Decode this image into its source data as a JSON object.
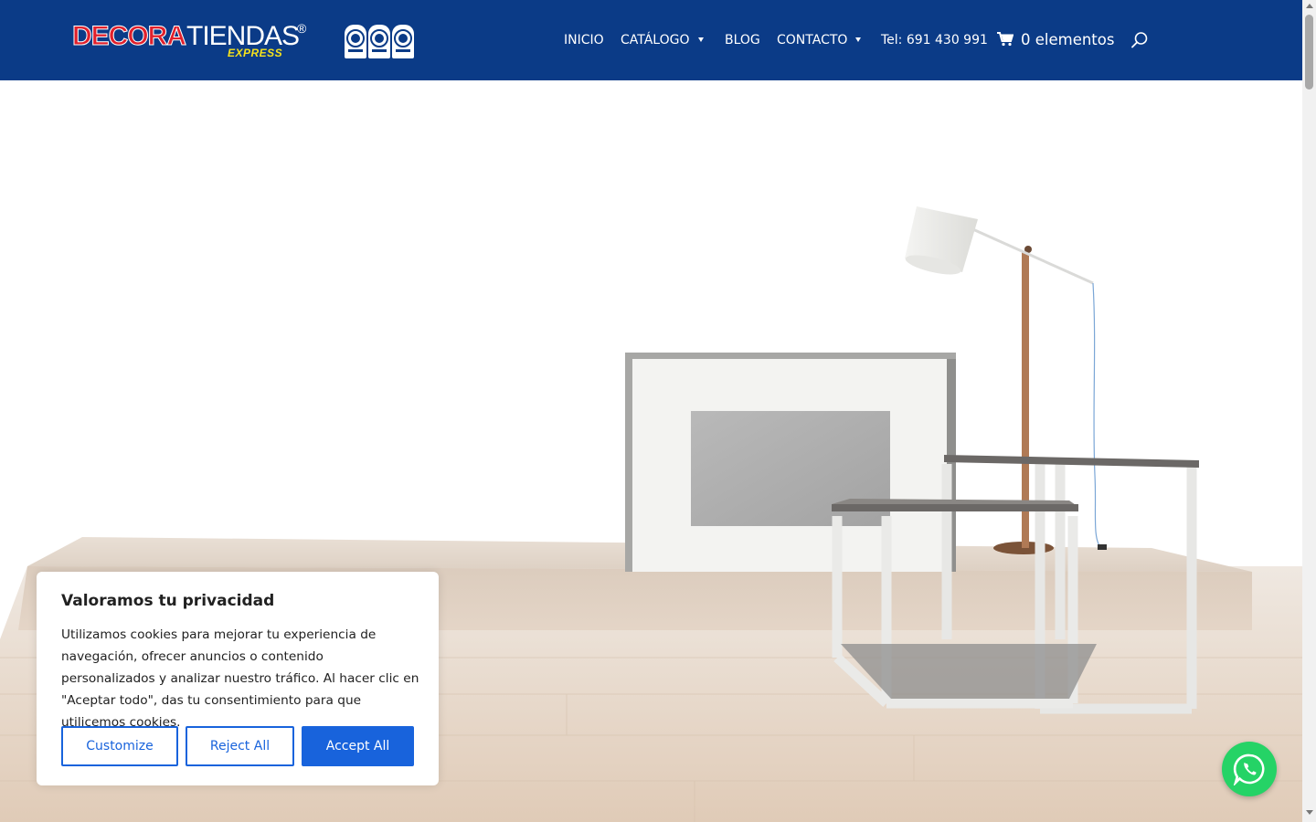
{
  "header": {
    "bg_color": "#0b3b87",
    "logo": {
      "part1": "DECORA",
      "part2": "TIENDAS",
      "registered": "®",
      "subtitle": "EXPRESS"
    },
    "certifications": [
      "ISO 45001",
      "ISO 9001",
      "ISO 14001"
    ],
    "nav": {
      "inicio": "INICIO",
      "catalogo": "CATÁLOGO",
      "blog": "BLOG",
      "contacto": "CONTACTO",
      "tel": "Tel: 691 430 991"
    },
    "cart": {
      "label": "0 elementos",
      "icon": "cart-icon"
    },
    "search": {
      "icon": "search-icon"
    }
  },
  "hero": {
    "description": "showroom scene: white partition panel, floor lamp, two nesting side tables on a wooden platform"
  },
  "cookie_banner": {
    "title": "Valoramos tu privacidad",
    "text": "Utilizamos cookies para mejorar tu experiencia de navegación, ofrecer anuncios o contenido personalizados y analizar nuestro tráfico. Al hacer clic en \"Aceptar todo\", das tu consentimiento para que utilicemos cookies.",
    "customize": "Customize",
    "reject": "Reject All",
    "accept": "Accept All",
    "accent_color": "#1863dc"
  },
  "whatsapp": {
    "icon": "whatsapp-icon",
    "color": "#25d366"
  }
}
